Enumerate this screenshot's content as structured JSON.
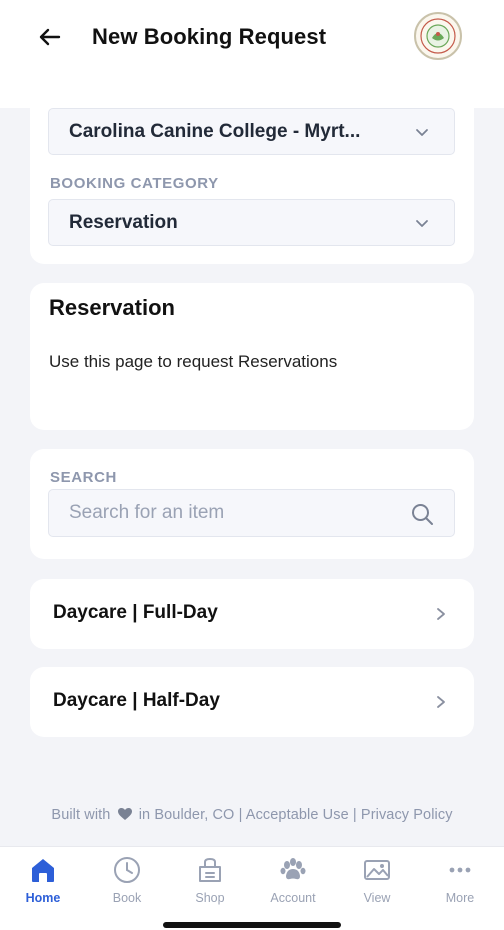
{
  "header": {
    "title": "New Booking Request"
  },
  "booking": {
    "location_value": "Carolina Canine College - Myrt...",
    "category_label": "BOOKING CATEGORY",
    "category_value": "Reservation"
  },
  "info": {
    "title": "Reservation",
    "description": "Use this page to request Reservations"
  },
  "search": {
    "label": "SEARCH",
    "placeholder": "Search for an item"
  },
  "items": [
    {
      "label": "Daycare | Full-Day"
    },
    {
      "label": "Daycare | Half-Day"
    }
  ],
  "footer": {
    "built_with": "Built with",
    "location": "in Boulder, CO",
    "separator": "|",
    "acceptable_use": "Acceptable Use",
    "privacy_policy": "Privacy Policy"
  },
  "tabs": [
    {
      "label": "Home",
      "icon": "home-icon",
      "active": true
    },
    {
      "label": "Book",
      "icon": "clock-icon",
      "active": false
    },
    {
      "label": "Shop",
      "icon": "shop-icon",
      "active": false
    },
    {
      "label": "Account",
      "icon": "paw-icon",
      "active": false
    },
    {
      "label": "View",
      "icon": "image-icon",
      "active": false
    },
    {
      "label": "More",
      "icon": "more-icon",
      "active": false
    }
  ],
  "colors": {
    "accent": "#2d5fd8",
    "background": "#f3f4f8",
    "muted_text": "#8e97ad"
  }
}
